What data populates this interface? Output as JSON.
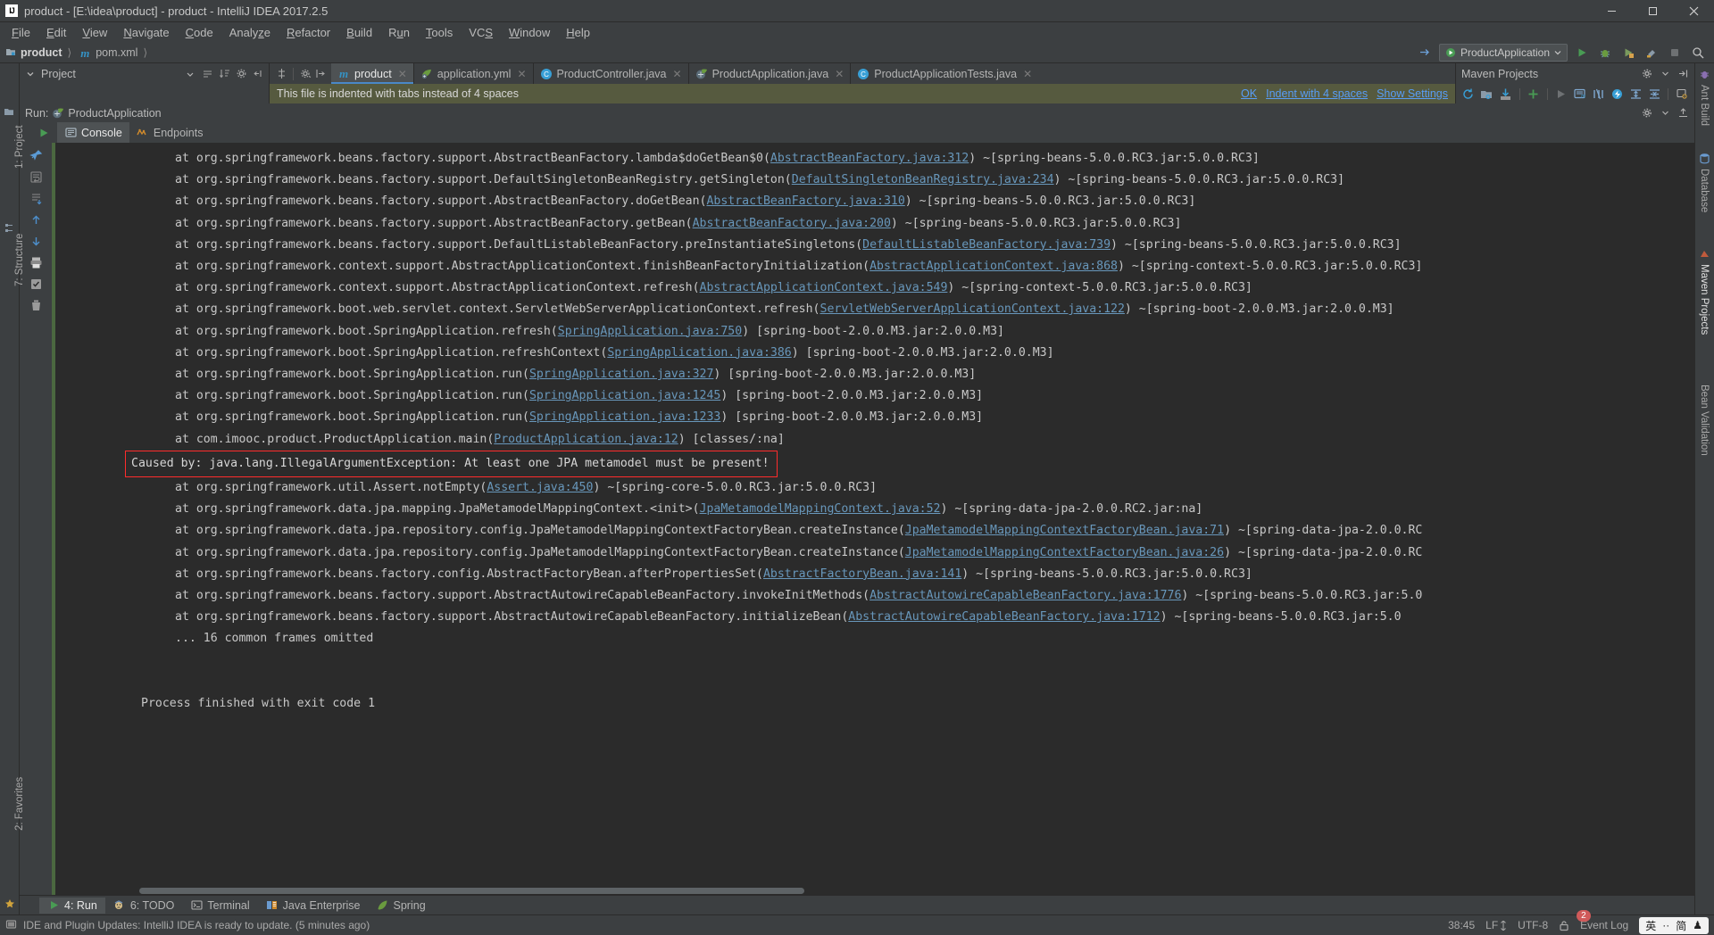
{
  "window": {
    "title": "product - [E:\\idea\\product] - product - IntelliJ IDEA 2017.2.5",
    "logo": "IJ",
    "minimize": "—",
    "maximize": "❐",
    "close": "✕"
  },
  "menubar": {
    "items": [
      {
        "label": "File",
        "mnemonic": "F"
      },
      {
        "label": "Edit",
        "mnemonic": "E"
      },
      {
        "label": "View",
        "mnemonic": "V"
      },
      {
        "label": "Navigate",
        "mnemonic": "N"
      },
      {
        "label": "Code",
        "mnemonic": "C"
      },
      {
        "label": "Analyze",
        "mnemonic": "z"
      },
      {
        "label": "Refactor",
        "mnemonic": "R"
      },
      {
        "label": "Build",
        "mnemonic": "B"
      },
      {
        "label": "Run",
        "mnemonic": "u"
      },
      {
        "label": "Tools",
        "mnemonic": "T"
      },
      {
        "label": "VCS",
        "mnemonic": "S"
      },
      {
        "label": "Window",
        "mnemonic": "W"
      },
      {
        "label": "Help",
        "mnemonic": "H"
      }
    ]
  },
  "navbar": {
    "breadcrumbs": [
      {
        "label": "product",
        "icon": "module-icon"
      },
      {
        "label": "pom.xml",
        "icon": "maven-m-icon"
      }
    ],
    "run_config": "ProductApplication",
    "icons": [
      "run-icon",
      "debug-icon",
      "run-with-coverage-icon",
      "build-icon",
      "stop-icon",
      "attach-icon",
      "search-icon"
    ]
  },
  "project_panel": {
    "title": "Project",
    "icons": [
      "chevron-down-icon",
      "collapse-all-icon",
      "sort-icon",
      "gear-icon",
      "hide-icon"
    ]
  },
  "editor_tabs": {
    "toolbar_icons": [
      "split-icon",
      "settings-icon",
      "restore-icon"
    ],
    "tabs": [
      {
        "label": "product",
        "icon": "maven-m-icon",
        "active": true
      },
      {
        "label": "application.yml",
        "icon": "yml-icon",
        "active": false
      },
      {
        "label": "ProductController.java",
        "icon": "class-icon",
        "active": false
      },
      {
        "label": "ProductApplication.java",
        "icon": "spring-class-icon",
        "active": false
      },
      {
        "label": "ProductApplicationTests.java",
        "icon": "class-icon",
        "active": false
      }
    ]
  },
  "notification": {
    "message": "This file is indented with tabs instead of 4 spaces",
    "actions": [
      "OK",
      "Indent with 4 spaces",
      "Show Settings"
    ]
  },
  "maven_panel": {
    "title": "Maven Projects",
    "icons": [
      "gear-icon",
      "hide-icon"
    ],
    "toolbar_icons": [
      "reimport-icon",
      "generate-sources-icon",
      "download-sources-icon",
      "add-icon",
      "run-icon",
      "execute-goal-icon",
      "skip-tests-icon",
      "toggle-offline-icon",
      "expand-all-icon",
      "collapse-all-icon",
      "settings-icon"
    ]
  },
  "run_window": {
    "label": "Run:",
    "config_name": "ProductApplication",
    "tabs": [
      {
        "label": "Console",
        "icon": "console-icon",
        "active": true
      },
      {
        "label": "Endpoints",
        "icon": "endpoints-icon",
        "active": false
      }
    ],
    "gutter_icons": [
      "rerun-icon",
      "stop-icon",
      "pin-icon",
      "up-icon",
      "down-icon",
      "soft-wrap-icon",
      "scroll-end-icon",
      "print-icon",
      "clear-all-icon"
    ],
    "side_icons": [
      "edit-icon",
      "arrow-up-icon",
      "arrow-down-icon",
      "filter-icon",
      "settings-icon",
      "trash-icon",
      "close-icon",
      "help-icon"
    ]
  },
  "console": {
    "lines": [
      {
        "kind": "frame",
        "prefix": "at org.springframework.beans.factory.support.AbstractBeanFactory.lambda$doGetBean$0(",
        "link": "AbstractBeanFactory.java:312",
        "suffix": ") ~[spring-beans-5.0.0.RC3.jar:5.0.0.RC3]"
      },
      {
        "kind": "frame",
        "prefix": "at org.springframework.beans.factory.support.DefaultSingletonBeanRegistry.getSingleton(",
        "link": "DefaultSingletonBeanRegistry.java:234",
        "suffix": ") ~[spring-beans-5.0.0.RC3.jar:5.0.0.RC3]"
      },
      {
        "kind": "frame",
        "prefix": "at org.springframework.beans.factory.support.AbstractBeanFactory.doGetBean(",
        "link": "AbstractBeanFactory.java:310",
        "suffix": ") ~[spring-beans-5.0.0.RC3.jar:5.0.0.RC3]"
      },
      {
        "kind": "frame",
        "prefix": "at org.springframework.beans.factory.support.AbstractBeanFactory.getBean(",
        "link": "AbstractBeanFactory.java:200",
        "suffix": ") ~[spring-beans-5.0.0.RC3.jar:5.0.0.RC3]"
      },
      {
        "kind": "frame",
        "prefix": "at org.springframework.beans.factory.support.DefaultListableBeanFactory.preInstantiateSingletons(",
        "link": "DefaultListableBeanFactory.java:739",
        "suffix": ") ~[spring-beans-5.0.0.RC3.jar:5.0.0.RC3]"
      },
      {
        "kind": "frame",
        "prefix": "at org.springframework.context.support.AbstractApplicationContext.finishBeanFactoryInitialization(",
        "link": "AbstractApplicationContext.java:868",
        "suffix": ") ~[spring-context-5.0.0.RC3.jar:5.0.0.RC3]"
      },
      {
        "kind": "frame",
        "prefix": "at org.springframework.context.support.AbstractApplicationContext.refresh(",
        "link": "AbstractApplicationContext.java:549",
        "suffix": ") ~[spring-context-5.0.0.RC3.jar:5.0.0.RC3]"
      },
      {
        "kind": "frame",
        "prefix": "at org.springframework.boot.web.servlet.context.ServletWebServerApplicationContext.refresh(",
        "link": "ServletWebServerApplicationContext.java:122",
        "suffix": ") ~[spring-boot-2.0.0.M3.jar:2.0.0.M3]"
      },
      {
        "kind": "frame",
        "prefix": "at org.springframework.boot.SpringApplication.refresh(",
        "link": "SpringApplication.java:750",
        "suffix": ") [spring-boot-2.0.0.M3.jar:2.0.0.M3]"
      },
      {
        "kind": "frame",
        "prefix": "at org.springframework.boot.SpringApplication.refreshContext(",
        "link": "SpringApplication.java:386",
        "suffix": ") [spring-boot-2.0.0.M3.jar:2.0.0.M3]"
      },
      {
        "kind": "frame",
        "prefix": "at org.springframework.boot.SpringApplication.run(",
        "link": "SpringApplication.java:327",
        "suffix": ") [spring-boot-2.0.0.M3.jar:2.0.0.M3]"
      },
      {
        "kind": "frame",
        "prefix": "at org.springframework.boot.SpringApplication.run(",
        "link": "SpringApplication.java:1245",
        "suffix": ") [spring-boot-2.0.0.M3.jar:2.0.0.M3]"
      },
      {
        "kind": "frame",
        "prefix": "at org.springframework.boot.SpringApplication.run(",
        "link": "SpringApplication.java:1233",
        "suffix": ") [spring-boot-2.0.0.M3.jar:2.0.0.M3]"
      },
      {
        "kind": "frame",
        "prefix": "at com.imooc.product.ProductApplication.main(",
        "link": "ProductApplication.java:12",
        "suffix": ") [classes/:na]"
      },
      {
        "kind": "error",
        "text": "Caused by: java.lang.IllegalArgumentException: At least one JPA metamodel must be present!"
      },
      {
        "kind": "frame",
        "prefix": "at org.springframework.util.Assert.notEmpty(",
        "link": "Assert.java:450",
        "suffix": ") ~[spring-core-5.0.0.RC3.jar:5.0.0.RC3]"
      },
      {
        "kind": "frame",
        "prefix": "at org.springframework.data.jpa.mapping.JpaMetamodelMappingContext.<init>(",
        "link": "JpaMetamodelMappingContext.java:52",
        "suffix": ") ~[spring-data-jpa-2.0.0.RC2.jar:na]"
      },
      {
        "kind": "frame",
        "prefix": "at org.springframework.data.jpa.repository.config.JpaMetamodelMappingContextFactoryBean.createInstance(",
        "link": "JpaMetamodelMappingContextFactoryBean.java:71",
        "suffix": ") ~[spring-data-jpa-2.0.0.RC"
      },
      {
        "kind": "frame",
        "prefix": "at org.springframework.data.jpa.repository.config.JpaMetamodelMappingContextFactoryBean.createInstance(",
        "link": "JpaMetamodelMappingContextFactoryBean.java:26",
        "suffix": ") ~[spring-data-jpa-2.0.0.RC"
      },
      {
        "kind": "frame",
        "prefix": "at org.springframework.beans.factory.config.AbstractFactoryBean.afterPropertiesSet(",
        "link": "AbstractFactoryBean.java:141",
        "suffix": ") ~[spring-beans-5.0.0.RC3.jar:5.0.0.RC3]"
      },
      {
        "kind": "frame",
        "prefix": "at org.springframework.beans.factory.support.AbstractAutowireCapableBeanFactory.invokeInitMethods(",
        "link": "AbstractAutowireCapableBeanFactory.java:1776",
        "suffix": ") ~[spring-beans-5.0.0.RC3.jar:5.0"
      },
      {
        "kind": "frame",
        "prefix": "at org.springframework.beans.factory.support.AbstractAutowireCapableBeanFactory.initializeBean(",
        "link": "AbstractAutowireCapableBeanFactory.java:1712",
        "suffix": ") ~[spring-beans-5.0.0.RC3.jar:5.0"
      },
      {
        "kind": "omitted",
        "text": "... 16 common frames omitted"
      },
      {
        "kind": "blank",
        "text": ""
      },
      {
        "kind": "blank",
        "text": ""
      },
      {
        "kind": "plain",
        "text": "Process finished with exit code 1"
      }
    ]
  },
  "left_strip": {
    "items": [
      {
        "label": "1: Project",
        "selected": false
      },
      {
        "label": "7: Structure",
        "selected": false
      },
      {
        "label": "2: Favorites",
        "selected": false
      }
    ]
  },
  "right_strip": {
    "items": [
      {
        "label": "Ant Build",
        "selected": false
      },
      {
        "label": "Database",
        "selected": false
      },
      {
        "label": "Maven Projects",
        "selected": true
      },
      {
        "label": "Bean Validation",
        "selected": false
      }
    ]
  },
  "bottom_strip": {
    "items": [
      {
        "label": "4: Run",
        "mnemonic": "4",
        "icon": "run-icon",
        "active": true
      },
      {
        "label": "6: TODO",
        "mnemonic": "6",
        "icon": "todo-icon",
        "active": false
      },
      {
        "label": "Terminal",
        "mnemonic": "",
        "icon": "terminal-icon",
        "active": false
      },
      {
        "label": "Java Enterprise",
        "mnemonic": "",
        "icon": "javaee-icon",
        "active": false
      },
      {
        "label": "Spring",
        "mnemonic": "",
        "icon": "spring-leaf-icon",
        "active": false
      }
    ]
  },
  "statusbar": {
    "message": "IDE and Plugin Updates: IntelliJ IDEA is ready to update. (5 minutes ago)",
    "position": "38:45",
    "line_separator": "LF",
    "encoding": "UTF-8",
    "lock_icon": "lock-icon",
    "event_log": "Event Log",
    "notification_count": "2",
    "ime": {
      "lang": "英",
      "dot": "··",
      "mode": "简",
      "shape": "♟"
    }
  },
  "colors": {
    "bg": "#3c3f41",
    "console_bg": "#2b2b2b",
    "accent_blue": "#4a88c7",
    "link": "#6897bb",
    "error_red": "#ff6b68",
    "error_border": "#ff2c2c",
    "notif_bg": "#565a3f",
    "notif_link": "#589df6",
    "green": "#499c54"
  }
}
